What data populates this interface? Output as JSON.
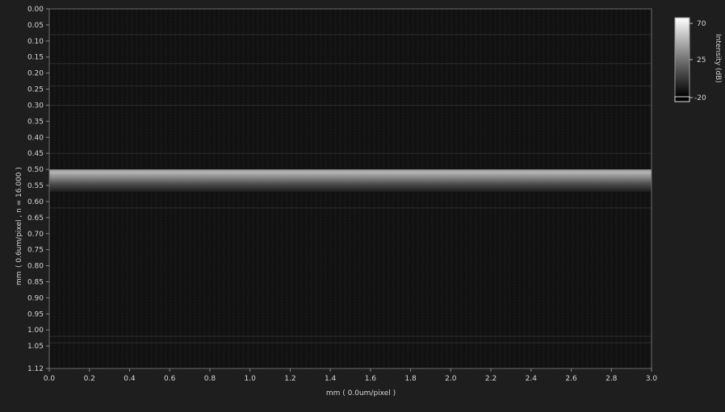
{
  "colors": {
    "window_bg": "#1e1e1e",
    "plot_bg": "#121212",
    "axis_text": "#d6d6d6",
    "axis_line": "#8a8a8a",
    "band_bright": "#bdbdbd"
  },
  "y_axis": {
    "title_line1": "mm",
    "title_line2": "( 0.6um/pixel ,  n = 16.000 )",
    "ticks": [
      "0.00",
      "0.05",
      "0.10",
      "0.15",
      "0.20",
      "0.25",
      "0.30",
      "0.35",
      "0.40",
      "0.45",
      "0.50",
      "0.55",
      "0.60",
      "0.65",
      "0.70",
      "0.75",
      "0.80",
      "0.85",
      "0.90",
      "0.95",
      "1.00",
      "1.05"
    ],
    "end_tick": "1.12"
  },
  "x_axis": {
    "title": "mm  ( 0.0um/pixel )",
    "ticks": [
      "0.0",
      "0.2",
      "0.4",
      "0.6",
      "0.8",
      "1.0",
      "1.2",
      "1.4",
      "1.6",
      "1.8",
      "2.0",
      "2.2",
      "2.4",
      "2.6",
      "2.8",
      "3.0"
    ]
  },
  "colorbar": {
    "title": "Intensity (dB)",
    "max_label": "70",
    "mid_label": "25",
    "min_label": "-20"
  },
  "image_content": {
    "bright_band_depth_mm": [
      0.5,
      0.57
    ],
    "faint_lines_depth_mm": [
      0.08,
      0.17,
      0.24,
      0.3,
      0.45,
      0.62,
      1.02,
      1.04
    ]
  }
}
